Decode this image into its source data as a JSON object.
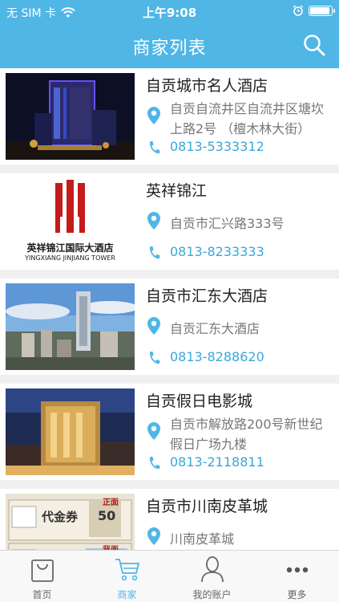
{
  "status_bar": {
    "carrier": "无 SIM 卡",
    "time": "上午9:08",
    "battery_level": 0.95
  },
  "nav": {
    "title": "商家列表",
    "search_icon": "search-icon"
  },
  "merchants": [
    {
      "name": "自贡城市名人酒店",
      "address": "自贡自流井区自流井区塘坎上路2号 （檀木林大街）",
      "phone": "0813-5333312",
      "image": "hotel-night-photo"
    },
    {
      "name": "英祥锦江",
      "address": "自贡市汇兴路333号",
      "phone": "0813-8233333",
      "image": "yingxiang-jinjiang-logo",
      "logo_text_cn": "英祥锦江国际大酒店",
      "logo_text_en": "YINGXIANG JINJIANG TOWER"
    },
    {
      "name": "自贡市汇东大酒店",
      "address": "自贡汇东大酒店",
      "phone": "0813-8288620",
      "image": "city-skyline-photo"
    },
    {
      "name": "自贡假日电影城",
      "address": "自贡市解放路200号新世纪假日广场九楼",
      "phone": "0813-2118811",
      "image": "building-night-photo"
    },
    {
      "name": "自贡市川南皮革城",
      "address": "川南皮革城",
      "phone": "",
      "image": "voucher-photo",
      "voucher_title": "代金券",
      "voucher_tag": "正面",
      "voucher_back": "背面",
      "voucher_amount": "50"
    }
  ],
  "tabs": [
    {
      "label": "首页",
      "icon": "bag-icon",
      "active": false
    },
    {
      "label": "商家",
      "icon": "cart-icon",
      "active": true
    },
    {
      "label": "我的账户",
      "icon": "person-icon",
      "active": false
    },
    {
      "label": "更多",
      "icon": "more-icon",
      "active": false
    }
  ],
  "colors": {
    "accent": "#4fb6e5",
    "phone": "#3aa7d8",
    "separator": "#f0f0f0"
  }
}
